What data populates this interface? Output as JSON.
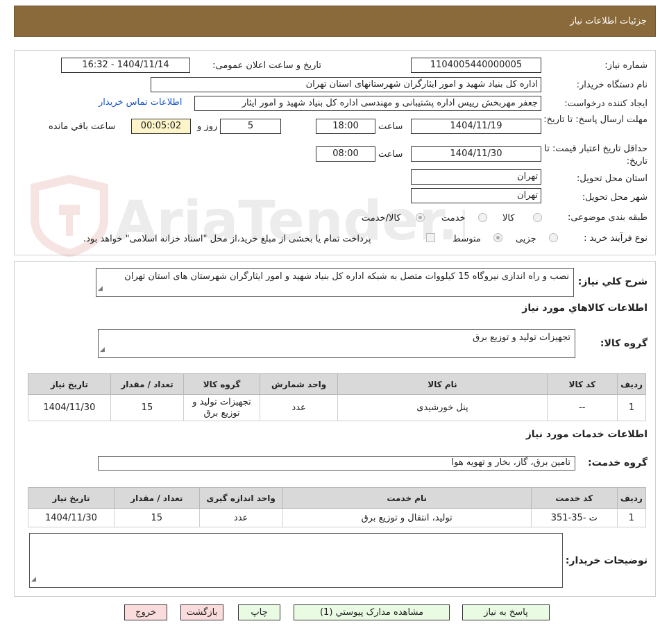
{
  "header": {
    "title": "جزئیات اطلاعات نیاز"
  },
  "form": {
    "need_number_label": "شماره نیاز:",
    "need_number": "1104005440000005",
    "announce_label": "تاریخ و ساعت اعلان عمومی:",
    "announce_value": "1404/11/14 - 16:32",
    "buyer_org_label": "نام دستگاه خریدار:",
    "buyer_org": "اداره کل بنیاد شهید و امور ایثارگران شهرستانهای استان تهران",
    "creator_label": "ایجاد کننده درخواست:",
    "creator": "جعفر مهربخش رییس اداره پشتیبانی و مهندسی اداره کل بنیاد شهید و امور ایثار",
    "contact_link": "اطلاعات تماس خریدار",
    "deadline_label": "مهلت ارسال پاسخ: تا تاریخ:",
    "deadline_date": "1404/11/19",
    "time_word": "ساعت",
    "deadline_time": "18:00",
    "days_value": "5",
    "days_word": "روز و",
    "remaining_time": "00:05:02",
    "remaining_word": "ساعت باقي مانده",
    "validity_label": "حداقل تاریخ اعتبار قیمت: تا تاریخ:",
    "validity_date": "1404/11/30",
    "validity_time": "08:00",
    "province_label": "استان محل تحویل:",
    "province": "تهران",
    "city_label": "شهر محل تحویل:",
    "city": "تهران",
    "category_label": "طبقه بندی موضوعی:",
    "category_options": [
      "کالا",
      "خدمت",
      "کالا/خدمت"
    ],
    "process_label": "نوع فرآیند خرید :",
    "process_options": [
      "جزیی",
      "متوسط"
    ],
    "payment_note": "پرداخت تمام یا بخشی از مبلغ خرید،از محل \"اسناد خزانه اسلامی\" خواهد بود."
  },
  "summary": {
    "label": "شرح كلي نياز:",
    "text": "نصب و راه اندازی نیروگاه 15 کیلووات متصل به شبکه اداره کل بنیاد شهید و امور ایثارگران شهرستان های استان تهران"
  },
  "goods": {
    "section_title": "اطلاعات کالاهاي مورد نياز",
    "group_label": "گروه کالا:",
    "group_value": "تجهیزات تولید و توزیع برق",
    "headers": [
      "رديف",
      "کد کالا",
      "نام کالا",
      "واحد شمارش",
      "گروه کالا",
      "تعداد / مقدار",
      "تاریخ نیاز"
    ],
    "rows": [
      [
        "1",
        "--",
        "پنل خورشیدی",
        "عدد",
        "تجهیزات تولید و توزیع برق",
        "15",
        "1404/11/30"
      ]
    ]
  },
  "services": {
    "section_title": "اطلاعات خدمات مورد نياز",
    "group_label": "گروه خدمت:",
    "group_value": "تامین برق، گاز، بخار و تهویه هوا",
    "headers": [
      "رديف",
      "کد خدمت",
      "نام خدمت",
      "واحد اندازه گیری",
      "تعداد / مقدار",
      "تاریخ نیاز"
    ],
    "rows": [
      [
        "1",
        "ت -35-351",
        "تولید، انتقال و توزیع برق",
        "عدد",
        "15",
        "1404/11/30"
      ]
    ]
  },
  "buyer_notes": {
    "label": "توضیحات خریدار:",
    "value": ""
  },
  "buttons": {
    "reply": "پاسخ به نیاز",
    "attachments": "مشاهده مدارک پیوستي (1)",
    "print": "چاپ",
    "back": "بازگشت",
    "exit": "خروج"
  },
  "watermark": {
    "text": "AriaTender.neT"
  }
}
